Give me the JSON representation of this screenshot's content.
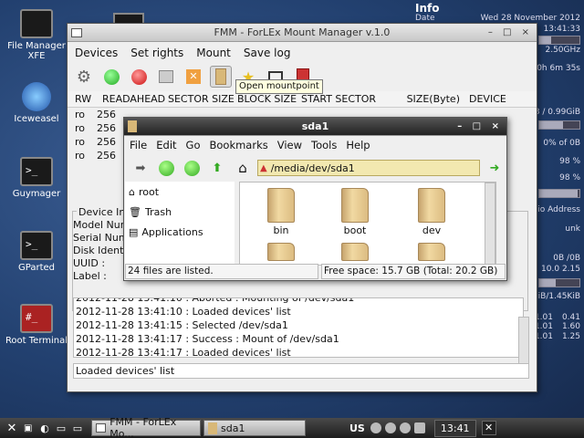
{
  "desktop_icons": [
    {
      "label": "File Manager",
      "sub": "XFE"
    },
    {
      "label": "Iceweasel"
    },
    {
      "label": "Guymager"
    },
    {
      "label": "GParted"
    },
    {
      "label": "Root Terminal"
    }
  ],
  "conky": {
    "title": "Info",
    "date_label": "Date",
    "date": "Wed 28 November 2012",
    "time": "13:41:33",
    "cpu": "2.50GHz",
    "uptime": "0h 6m 35s",
    "mem": "3 / 0.99GiB",
    "disk": "0% of 0B",
    "p1": "98 %",
    "p2": "98 %",
    "addr": "io Address",
    "unk": "unk",
    "net_a": "0B /0B",
    "net_b": "10.0 2.15",
    "rate": "GiB/1.45KiB",
    "load1": "0.41",
    "load2": "1.60",
    "load3": "1.25",
    "c1": "1.01",
    "c2": "1.01",
    "c3": "1.01"
  },
  "fmm": {
    "title": "FMM - ForLEx Mount Manager v.1.0",
    "menu": [
      "Devices",
      "Set rights",
      "Mount",
      "Save log"
    ],
    "tooltip": "Open mountpoint",
    "columns": [
      "RW",
      "READAHEAD",
      "SECTOR SIZE",
      "BLOCK SIZE",
      "START SECTOR",
      "SIZE(Byte)",
      "DEVICE"
    ],
    "rows": [
      {
        "rw": "ro",
        "ra": "256"
      },
      {
        "rw": "ro",
        "ra": "256"
      },
      {
        "rw": "ro",
        "ra": "256"
      },
      {
        "rw": "ro",
        "ra": "256"
      }
    ],
    "device_info_label": "Device Info",
    "fields": [
      "Model Num",
      "Serial Num",
      "Disk Identi",
      "UUID :",
      "Label :"
    ],
    "log": [
      "2012-11-28 13:41:10 : Aborted : Mounting of /dev/sda1",
      "2012-11-28 13:41:10 : Loaded devices' list",
      "2012-11-28 13:41:15 : Selected /dev/sda1",
      "2012-11-28 13:41:17 : Success : Mount of /dev/sda1",
      "2012-11-28 13:41:17 : Loaded devices' list"
    ],
    "status": "Loaded devices' list"
  },
  "fm": {
    "title": "sda1",
    "menu": [
      "File",
      "Edit",
      "Go",
      "Bookmarks",
      "View",
      "Tools",
      "Help"
    ],
    "path": "/media/dev/sda1",
    "sidebar": [
      "root",
      "Trash",
      "Applications"
    ],
    "folders": [
      "bin",
      "boot",
      "dev"
    ],
    "status_left": "24 files are listed.",
    "status_right": "Free space: 15.7 GB (Total: 20.2 GB)"
  },
  "taskbar": {
    "tasks": [
      "FMM - ForLEx Mo...",
      "sda1"
    ],
    "lang": "US",
    "clock": "13:41"
  }
}
